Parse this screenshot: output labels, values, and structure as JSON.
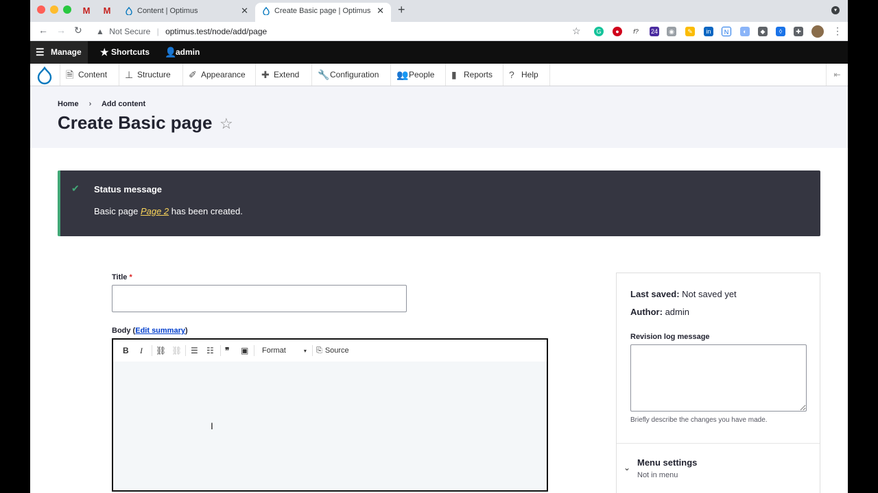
{
  "browser": {
    "tabs": [
      {
        "label": "Content | Optimus"
      },
      {
        "label": "Create Basic page | Optimus"
      }
    ],
    "url_security": "Not Secure",
    "url": "optimus.test/node/add/page",
    "extension_badge": "24"
  },
  "drupal_toolbar": {
    "manage": "Manage",
    "shortcuts": "Shortcuts",
    "user": "admin"
  },
  "admin_menu": {
    "items": [
      "Content",
      "Structure",
      "Appearance",
      "Extend",
      "Configuration",
      "People",
      "Reports",
      "Help"
    ]
  },
  "header": {
    "breadcrumb": [
      "Home",
      "Add content"
    ],
    "title": "Create Basic page"
  },
  "status": {
    "heading": "Status message",
    "prefix": "Basic page",
    "link": "Page 2",
    "suffix": "has been created."
  },
  "form": {
    "title_label": "Title",
    "required_mark": "*",
    "title_value": "",
    "body_label": "Body",
    "edit_summary": "Edit summary",
    "editor": {
      "bold": "B",
      "italic": "I",
      "format": "Format",
      "source": "Source"
    }
  },
  "sidebar": {
    "last_saved_label": "Last saved:",
    "last_saved_value": "Not saved yet",
    "author_label": "Author:",
    "author_value": "admin",
    "revision_label": "Revision log message",
    "revision_desc": "Briefly describe the changes you have made.",
    "menu_settings": "Menu settings",
    "menu_status": "Not in menu"
  },
  "colors": {
    "status_bg": "#353641",
    "status_accent": "#42a877",
    "link_yellow": "#fbd55b",
    "link_blue": "#003ecc"
  }
}
